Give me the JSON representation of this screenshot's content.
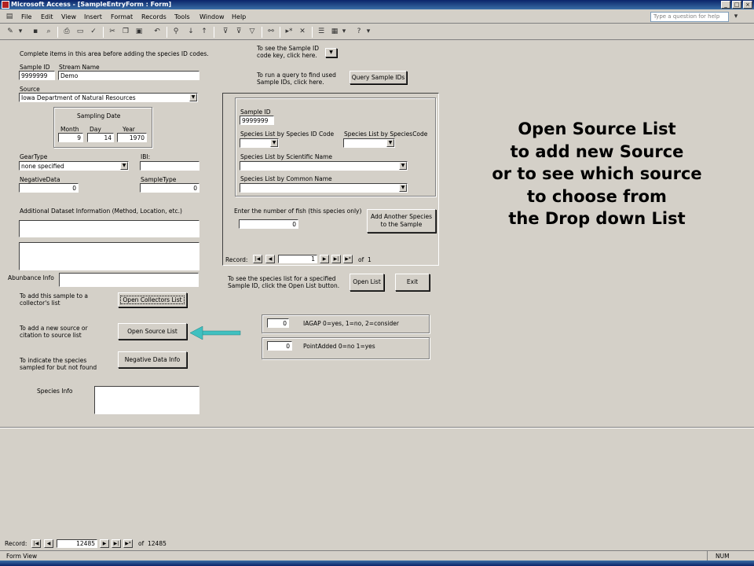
{
  "window": {
    "title": "Microsoft Access - [SampleEntryForm : Form]",
    "min": "_",
    "max": "□",
    "close": "×"
  },
  "menu": {
    "items": [
      "File",
      "Edit",
      "View",
      "Insert",
      "Format",
      "Records",
      "Tools",
      "Window",
      "Help"
    ],
    "help_placeholder": "Type a question for help"
  },
  "form": {
    "intro": "Complete items in this area before adding the species ID codes.",
    "sample_id_label": "Sample ID",
    "sample_id_value": "9999999",
    "stream_name_label": "Stream Name",
    "stream_name_value": "Demo",
    "source_label": "Source",
    "source_value": "Iowa Department of Natural Resources",
    "sampling_date_label": "Sampling Date",
    "month_label": "Month",
    "month_value": "9",
    "day_label": "Day",
    "day_value": "14",
    "year_label": "Year",
    "year_value": "1970",
    "geartype_label": "GearType",
    "geartype_value": "none specified",
    "ibi_label": "IBI:",
    "ibi_value": "",
    "negativedata_label": "NegativeData",
    "negativedata_value": "0",
    "sampletype_label": "SampleType",
    "sampletype_value": "0",
    "additional_label": "Additional Dataset Information (Method, Location, etc.)",
    "abundance_label": "Abunbance Info",
    "collectors_text_1": "To add this sample to a",
    "collectors_text_2": "collector's list",
    "collectors_button": "Open Collectors List",
    "source_text_1": "To add a new source or",
    "source_text_2": "citation to source list",
    "source_button": "Open Source List",
    "negative_text_1": "To indicate the species",
    "negative_text_2": "sampled for but not found",
    "negative_button": "Negative Data Info",
    "species_info_label": "Species Info",
    "key_text_1": "To see the Sample ID",
    "key_text_2": "code key, click here.",
    "query_text_1": "To run a query to find used",
    "query_text_2": "Sample IDs, click here.",
    "query_button": "Query Sample IDs"
  },
  "subform": {
    "sample_id_label": "Sample ID",
    "sample_id_value": "9999999",
    "by_id_label": "Species List by Species ID Code",
    "by_code_label": "Species List by SpeciesCode",
    "by_sci_label": "Species List by Scientific Name",
    "by_common_label": "Species List by Common Name",
    "fish_label": "Enter the number of fish (this species only)",
    "fish_value": "0",
    "add_button_1": "Add Another Species",
    "add_button_2": "to the Sample",
    "record_label": "Record:",
    "record_value": "1",
    "record_of": "of",
    "record_total": "1"
  },
  "lower": {
    "openlist_text_1": "To see the species list for a specified",
    "openlist_text_2": "Sample ID, click the Open List button.",
    "openlist_button": "Open List",
    "exit_button": "Exit",
    "iagap_value": "0",
    "iagap_label": "IAGAP  0=yes, 1=no, 2=consider",
    "pointadded_value": "0",
    "pointadded_label": "PointAdded 0=no 1=yes"
  },
  "annotation": {
    "lines": [
      "Open Source List",
      "to add new Source",
      "or to see which source",
      "to choose from",
      " the Drop down List"
    ],
    "arrow_color": "#40c0c0"
  },
  "recordnav": {
    "label": "Record:",
    "value": "12485",
    "of": "of",
    "total": "12485"
  },
  "status": {
    "view": "Form View",
    "num": "NUM"
  },
  "nav_icons": {
    "first": "|◀",
    "prev": "◀",
    "next": "▶",
    "last": "▶|",
    "new": "▶*"
  }
}
